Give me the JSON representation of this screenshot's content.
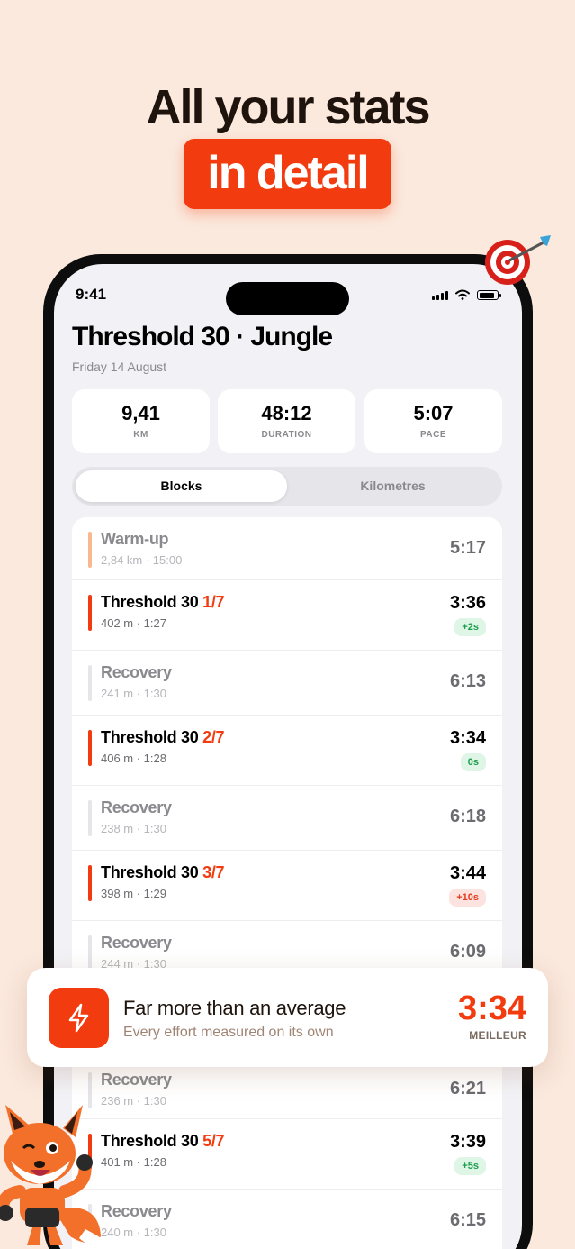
{
  "headline": {
    "line1": "All your stats",
    "line2": "in detail"
  },
  "status": {
    "time": "9:41"
  },
  "workout": {
    "title": "Threshold 30 · Jungle",
    "date": "Friday 14 August"
  },
  "stats": [
    {
      "value": "9,41",
      "label": "KM"
    },
    {
      "value": "48:12",
      "label": "DURATION"
    },
    {
      "value": "5:07",
      "label": "PACE"
    }
  ],
  "segment": {
    "active": "Blocks",
    "inactive": "Kilometres"
  },
  "blocks": [
    {
      "kind": "warm",
      "name": "Warm-up",
      "frac": "",
      "sub": "2,84 km · 15:00",
      "pace": "5:17",
      "delta": ""
    },
    {
      "kind": "work",
      "name": "Threshold 30",
      "frac": "1/7",
      "sub": "402 m · 1:27",
      "pace": "3:36",
      "delta": "+2s",
      "delta_color": "green"
    },
    {
      "kind": "rest",
      "name": "Recovery",
      "frac": "",
      "sub": "241 m · 1:30",
      "pace": "6:13",
      "delta": ""
    },
    {
      "kind": "work",
      "name": "Threshold 30",
      "frac": "2/7",
      "sub": "406 m · 1:28",
      "pace": "3:34",
      "delta": "0s",
      "delta_color": "green"
    },
    {
      "kind": "rest",
      "name": "Recovery",
      "frac": "",
      "sub": "238 m · 1:30",
      "pace": "6:18",
      "delta": ""
    },
    {
      "kind": "work",
      "name": "Threshold 30",
      "frac": "3/7",
      "sub": "398 m · 1:29",
      "pace": "3:44",
      "delta": "+10s",
      "delta_color": "red"
    },
    {
      "kind": "rest",
      "name": "Recovery",
      "frac": "",
      "sub": "244 m · 1:30",
      "pace": "6:09",
      "delta": ""
    },
    {
      "kind": "rest",
      "name": "Recovery",
      "frac": "",
      "sub": "236 m · 1:30",
      "pace": "6:21",
      "delta": ""
    },
    {
      "kind": "work",
      "name": "Threshold 30",
      "frac": "5/7",
      "sub": "401 m · 1:28",
      "pace": "3:39",
      "delta": "+5s",
      "delta_color": "green"
    },
    {
      "kind": "rest",
      "name": "Recovery",
      "frac": "",
      "sub": "240 m · 1:30",
      "pace": "6:15",
      "delta": ""
    }
  ],
  "highlight": {
    "title": "Far more than an average",
    "subtitle": "Every effort measured on its own",
    "value": "3:34",
    "label": "MEILLEUR"
  },
  "colors": {
    "accent": "#f23b0e",
    "background": "#fbe9dd"
  },
  "icons": [
    "target-icon",
    "bolt-icon",
    "fox-mascot"
  ]
}
